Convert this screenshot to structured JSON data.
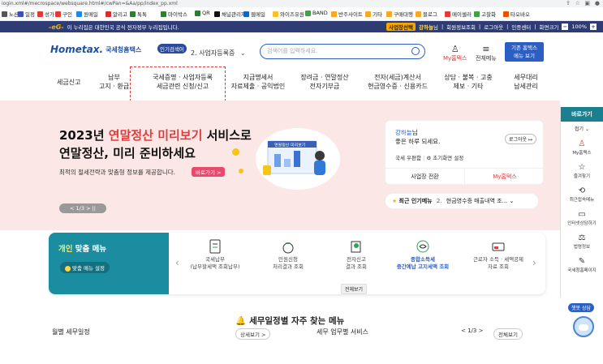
{
  "browser": {
    "url": "iogin.xml#/mecrospace/websquare.html#/cwPan=&Aa/pp/index_pp.xml"
  },
  "bookmarks": [
    {
      "label": "노션",
      "color": "#555"
    },
    {
      "label": "일정",
      "color": "#3f51b5"
    },
    {
      "label": "성가",
      "color": "#e53935"
    },
    {
      "label": "구인",
      "color": "#e53935"
    },
    {
      "label": "원메일",
      "color": "#1e88e5"
    },
    {
      "label": "알리고",
      "color": "#d32f2f"
    },
    {
      "label": "톡톡",
      "color": "#2e7d32"
    },
    {
      "label": "마이박스",
      "color": "#2e7d32"
    },
    {
      "label": "QR",
      "color": "#2e7d32"
    },
    {
      "label": "채널관리자",
      "color": "#111"
    },
    {
      "label": "웹메일",
      "color": "#1565c0"
    },
    {
      "label": "와이즈유원",
      "color": "#fbc02d"
    },
    {
      "label": "BAND",
      "color": "#43a047"
    },
    {
      "label": "반주사이트",
      "color": "#f9a825"
    },
    {
      "label": "기타",
      "color": "#f9a825"
    },
    {
      "label": "구매대행",
      "color": "#f9a825"
    },
    {
      "label": "블로그",
      "color": "#f9a825"
    },
    {
      "label": "메이셀러",
      "color": "#e53935"
    },
    {
      "label": "고찰화",
      "color": "#43a047"
    },
    {
      "label": "타오바오",
      "color": "#e65100"
    }
  ],
  "topbar": {
    "gov_mark": "-eG-",
    "gov_text": "이 누리집은 대한민국 공식 전자정부 누리집입니다.",
    "business_select": "사업장선택",
    "user_name": "강하늘",
    "user_suffix": "님",
    "links": [
      "회원정보조회",
      "로그아웃",
      "인증센터",
      "화면크기"
    ],
    "zoom": "100%"
  },
  "header": {
    "logo_text": "Hometax.",
    "logo_sub": "국세청홈택스",
    "popular_badge": "인기검색어",
    "popular_rank": "2.",
    "popular_term": "사업자등록증",
    "search_placeholder": "검색어를 입력하세요.",
    "mytax": "My홈택스",
    "all_menu": "전체메뉴",
    "old_btn_line1": "기존 홈택스",
    "old_btn_line2": "메뉴 보기"
  },
  "gnb": [
    {
      "l1": "세금신고",
      "l2": ""
    },
    {
      "l1": "납부",
      "l2": "고지 · 환급"
    },
    {
      "l1": "국세증명 · 사업자등록",
      "l2": "세금관련 신청/신고"
    },
    {
      "l1": "지급명세서",
      "l2": "자료제출 · 공익법인"
    },
    {
      "l1": "장려금 · 연말정산",
      "l2": "전자기부금"
    },
    {
      "l1": "전자(세금)계산서",
      "l2": "현금영수증 · 신용카드"
    },
    {
      "l1": "상담 · 불복 · 고충",
      "l2": "제보 · 기타"
    },
    {
      "l1": "세무대리",
      "l2": "납세관리"
    }
  ],
  "hero": {
    "title_year": "2023년 ",
    "title_hl": "연말정산 미리보기",
    "title_rest": " 서비스로",
    "title_line2": "연말정산, 미리 준비하세요",
    "subtitle": "최적의 절세전략과 맞춤형 정보를 제공합니다.",
    "button": "바로가기 >",
    "pager": "< 1/3 > ||",
    "illus_label": "연말정산 미리보기"
  },
  "userbox": {
    "name": "강하늘",
    "suffix": "님",
    "greet": "좋은 하루 되세요.",
    "logout": "로그아웃",
    "mail": "국세 우편함",
    "reset": "초기화면 설정",
    "switch": "사업장 전환",
    "mytax": "My홈택스"
  },
  "popular_menu": {
    "label": "최근 인기메뉴",
    "rank": "2.",
    "item": "현금영수증 매출내역 조..."
  },
  "custom_menu": {
    "title_a": "개인",
    "title_b": " 맞춤 메뉴",
    "setting": "맞춤 메뉴 설정",
    "items": [
      {
        "l1": "국세납부",
        "l2": "(납부할세액 조회납부)",
        "icon": "document-icon"
      },
      {
        "l1": "민원신청",
        "l2": "처리결과 조회",
        "icon": "money-bag-icon"
      },
      {
        "l1": "전자신고",
        "l2": "결과 조회",
        "icon": "report-icon"
      },
      {
        "l1": "종합소득세",
        "l2": "중간예납 고지세액 조회",
        "icon": "handshake-icon"
      },
      {
        "l1": "근로자 소득 · 세액공제",
        "l2": "자료 조회",
        "icon": "card-icon"
      }
    ],
    "all_view": "전체보기"
  },
  "frequent": {
    "title": "세무일정별 자주 찾는 메뉴"
  },
  "bottom": {
    "monthly": "월별 세무일정",
    "monthly_btn": "상세보기 >",
    "service": "세무 업무별 서비스",
    "service_pager": "< 1/3 >",
    "service_btn": "전체보기"
  },
  "quick": {
    "header": "바로가기",
    "fold": "접기",
    "items": [
      {
        "label": "My홈택스",
        "icon": "person-icon",
        "accent": true
      },
      {
        "label": "즐겨찾기",
        "icon": "star-icon",
        "accent": false
      },
      {
        "label": "최근접속메뉴",
        "icon": "history-icon",
        "accent": false
      },
      {
        "label": "인터넷상담하기",
        "icon": "chat-icon",
        "accent": false
      },
      {
        "label": "법령정보",
        "icon": "gavel-icon",
        "accent": false
      },
      {
        "label": "국세청홈페이지",
        "icon": "home-edit-icon",
        "accent": false
      }
    ]
  },
  "chatbot": "챗봇 상담"
}
